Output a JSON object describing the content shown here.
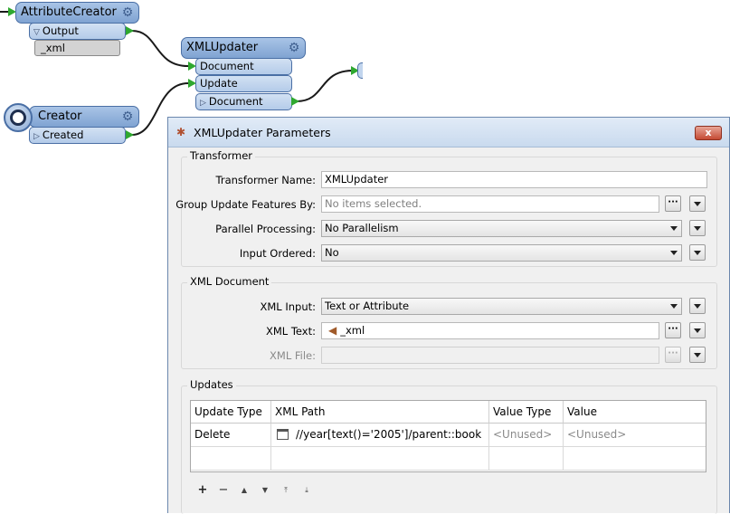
{
  "canvas": {
    "attribute_creator": {
      "title": "AttributeCreator",
      "output_port": "Output",
      "attribute": "_xml"
    },
    "xml_updater": {
      "title": "XMLUpdater",
      "input_document": "Document",
      "input_update": "Update",
      "output_document": "Document"
    },
    "creator": {
      "title": "Creator",
      "output_port": "Created"
    }
  },
  "dialog": {
    "title": "XMLUpdater Parameters",
    "close_label": "x",
    "transformer_group": {
      "title": "Transformer",
      "name_label": "Transformer Name:",
      "name_value": "XMLUpdater",
      "group_by_label": "Group Update Features By:",
      "group_by_placeholder": "No items selected.",
      "parallel_label": "Parallel Processing:",
      "parallel_value": "No Parallelism",
      "input_ordered_label": "Input Ordered:",
      "input_ordered_value": "No"
    },
    "xml_document_group": {
      "title": "XML Document",
      "xml_input_label": "XML Input:",
      "xml_input_value": "Text or Attribute",
      "xml_text_label": "XML Text:",
      "xml_text_value": "_xml",
      "xml_file_label": "XML File:"
    },
    "updates_group": {
      "title": "Updates",
      "columns": [
        "Update Type",
        "XML Path",
        "Value Type",
        "Value"
      ],
      "rows": [
        {
          "update_type": "Delete",
          "xml_path": "//year[text()='2005']/parent::book",
          "value_type": "<Unused>",
          "value": "<Unused>"
        }
      ]
    },
    "ellipsis_label": "···"
  }
}
